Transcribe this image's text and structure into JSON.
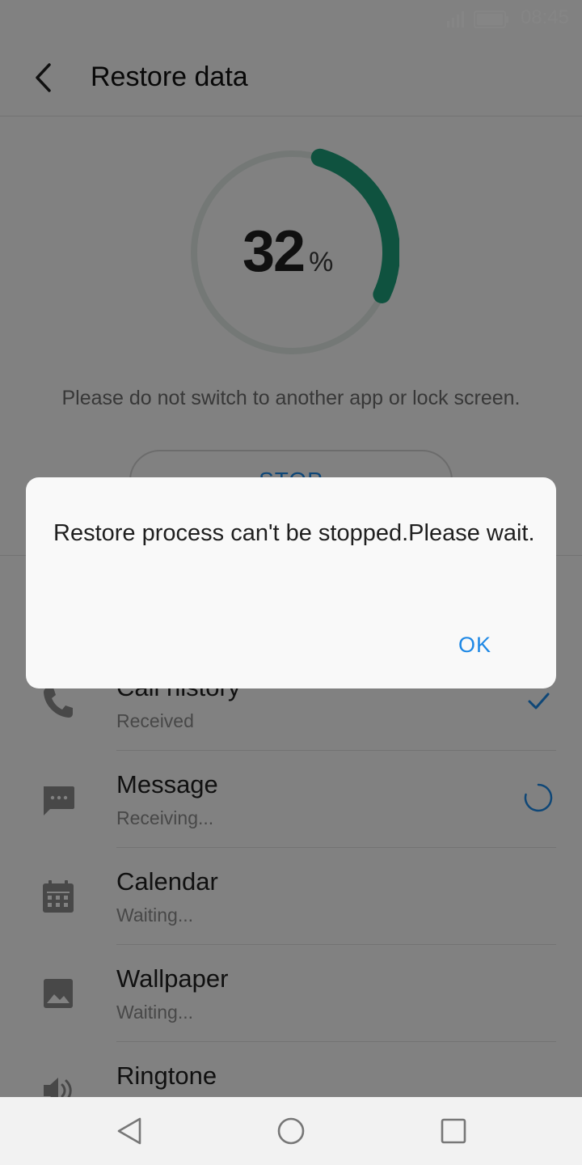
{
  "status_bar": {
    "time": "08:45"
  },
  "header": {
    "title": "Restore data"
  },
  "progress": {
    "value": "32",
    "unit": "%",
    "fraction": 0.32,
    "accent": "#1e9e7a"
  },
  "hint": "Please do not switch to another app or lock screen.",
  "stop_label": "STOP",
  "items": [
    {
      "title": "Call history",
      "status": "Received",
      "icon": "phone-icon",
      "state": "done"
    },
    {
      "title": "Message",
      "status": "Receiving...",
      "icon": "message-icon",
      "state": "loading"
    },
    {
      "title": "Calendar",
      "status": "Waiting...",
      "icon": "calendar-icon",
      "state": "waiting"
    },
    {
      "title": "Wallpaper",
      "status": "Waiting...",
      "icon": "image-icon",
      "state": "waiting"
    },
    {
      "title": "Ringtone",
      "status": "",
      "icon": "speaker-icon",
      "state": "waiting"
    }
  ],
  "dialog": {
    "message": "Restore process can't be stopped.Please wait.",
    "ok_label": "OK"
  },
  "colors": {
    "accent_blue": "#1e88e5",
    "progress_green": "#1e9e7a"
  }
}
